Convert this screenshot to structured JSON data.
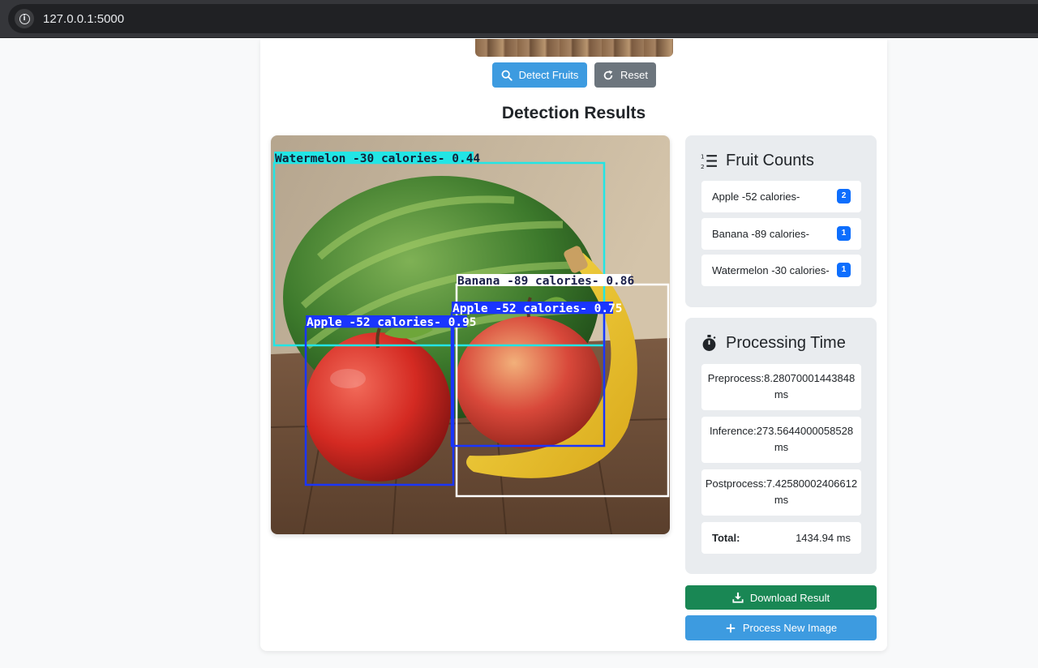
{
  "browser": {
    "url": "127.0.0.1:5000",
    "site_info_icon": "info-icon"
  },
  "actions": {
    "detect_label": "Detect Fruits",
    "reset_label": "Reset"
  },
  "results": {
    "title": "Detection Results",
    "detections": [
      {
        "label": "Watermelon -30 calories- 0.44",
        "color": "#22e5e5"
      },
      {
        "label": "Banana -89 calories- 0.86",
        "color": "#ffffff"
      },
      {
        "label": "Apple -52 calories- 0.75",
        "color": "#1a35ff"
      },
      {
        "label": "Apple -52 calories- 0.95",
        "color": "#1a35ff"
      }
    ]
  },
  "fruit_counts": {
    "title": "Fruit Counts",
    "icon": "list-ordered-icon",
    "items": [
      {
        "label": "Apple -52 calories-",
        "count": "2"
      },
      {
        "label": "Banana -89 calories-",
        "count": "1"
      },
      {
        "label": "Watermelon -30 calories-",
        "count": "1"
      }
    ]
  },
  "processing_time": {
    "title": "Processing Time",
    "icon": "stopwatch-icon",
    "preprocess": {
      "line1": "Preprocess:8.28070001443848",
      "line2": "ms"
    },
    "inference": {
      "line1": "Inference:273.5644000058528",
      "line2": "ms"
    },
    "postprocess": {
      "line1": "Postprocess:7.42580002406612",
      "line2": "ms"
    },
    "total_label": "Total:",
    "total_value": "1434.94 ms"
  },
  "footer_actions": {
    "download_label": "Download Result",
    "new_image_label": "Process New Image"
  },
  "colors": {
    "primary": "#3d9be0",
    "secondary": "#6c757d",
    "success": "#198754",
    "badge": "#0d6efd",
    "panel_bg": "#e9ecef"
  }
}
